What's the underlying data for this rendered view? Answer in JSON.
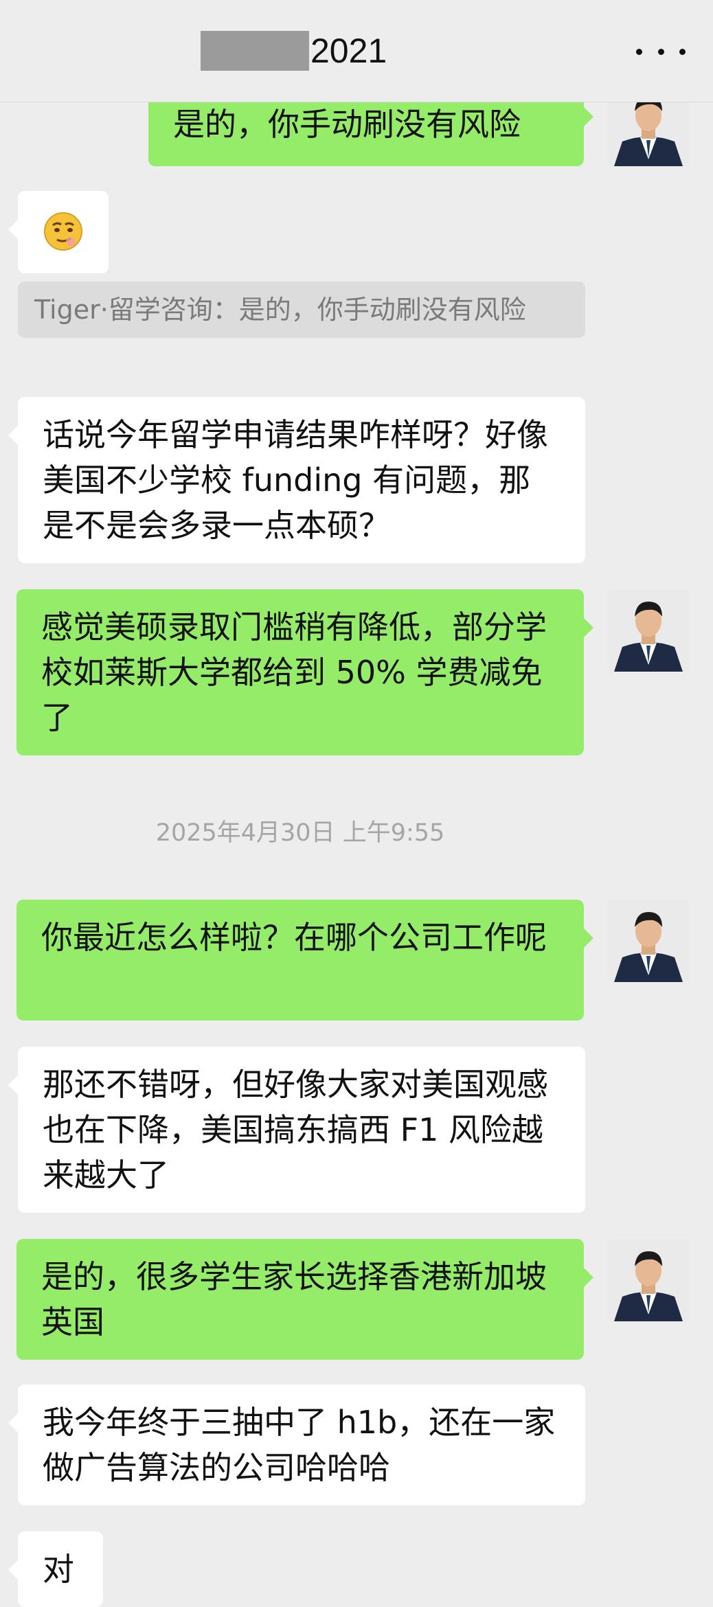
{
  "header": {
    "title_suffix": "2021",
    "more_icon": "more-horizontal-icon"
  },
  "messages": [
    {
      "id": "m1",
      "from": "me",
      "text": "是的，你手动刷没有风险"
    },
    {
      "id": "m2",
      "from": "other",
      "text": "",
      "emoji": "smirking-face-emoji"
    },
    {
      "id": "q1",
      "quote": "Tiger·留学咨询：是的，你手动刷没有风险"
    },
    {
      "id": "m3",
      "from": "other",
      "text": "话说今年留学申请结果咋样呀？好像美国不少学校 funding 有问题，那是不是会多录一点本硕？"
    },
    {
      "id": "m4",
      "from": "me",
      "text": "感觉美硕录取门槛稍有降低，部分学校如莱斯大学都给到 50% 学费减免了"
    },
    {
      "id": "t1",
      "timestamp": "2025年4月30日 上午9:55"
    },
    {
      "id": "m5",
      "from": "me",
      "text": "你最近怎么样啦？在哪个公司工作呢"
    },
    {
      "id": "m6",
      "from": "other",
      "text": "那还不错呀，但好像大家对美国观感也在下降，美国搞东搞西 F1 风险越来越大了"
    },
    {
      "id": "m7",
      "from": "me",
      "text": "是的，很多学生家长选择香港新加坡英国"
    },
    {
      "id": "m8",
      "from": "other",
      "text": "我今年终于三抽中了 h1b，还在一家做广告算法的公司哈哈哈"
    },
    {
      "id": "m9",
      "from": "other",
      "text": "对"
    }
  ],
  "colors": {
    "me_bubble": "#95ec69",
    "other_bubble": "#ffffff",
    "background": "#ededed",
    "quote_bg": "#dcdcdc",
    "timestamp_text": "#a5a5a5"
  }
}
